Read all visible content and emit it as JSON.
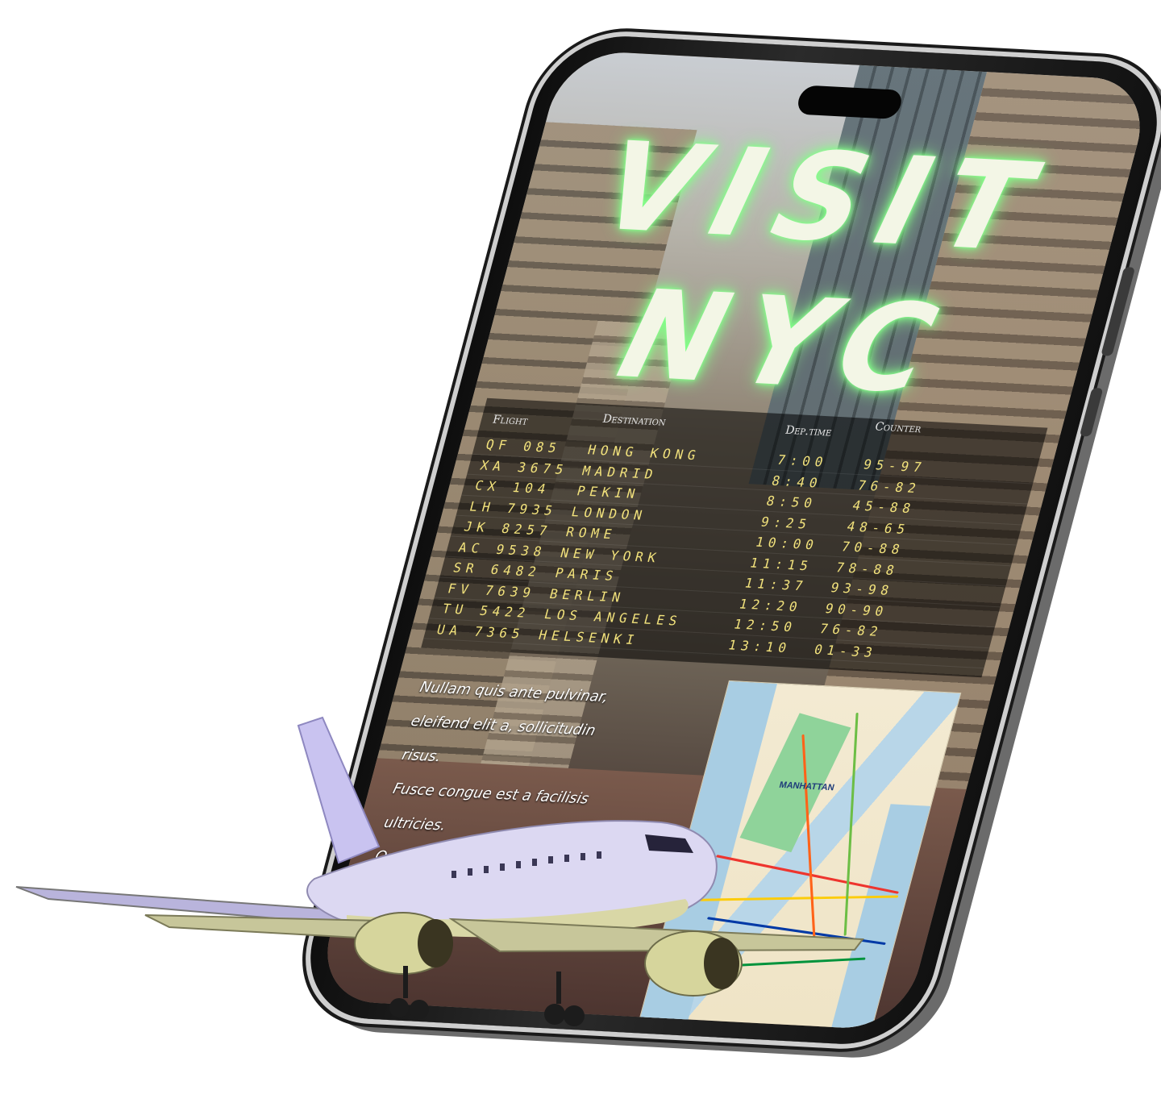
{
  "screen": {
    "title_line1": "VISIT",
    "title_line2": "NYC",
    "title_glow_color": "#7dff86"
  },
  "board": {
    "headers": {
      "flight": "Flight",
      "destination": "Destination",
      "dep_time": "Dep.time",
      "counter": "Counter"
    },
    "rows": [
      {
        "flight": "QF  085",
        "destination": "HONG KONG",
        "time": "7:00",
        "counter": "95-97"
      },
      {
        "flight": "XA  3675",
        "destination": "MADRID",
        "time": "8:40",
        "counter": "76-82"
      },
      {
        "flight": "CX  104",
        "destination": "PEKIN",
        "time": "8:50",
        "counter": "45-88"
      },
      {
        "flight": "LH  7935",
        "destination": "LONDON",
        "time": "9:25",
        "counter": "48-65"
      },
      {
        "flight": "JK  8257",
        "destination": "ROME",
        "time": "10:00",
        "counter": "70-88"
      },
      {
        "flight": "AC  9538",
        "destination": "NEW YORK",
        "time": "11:15",
        "counter": "78-88"
      },
      {
        "flight": "SR  6482",
        "destination": "PARIS",
        "time": "11:37",
        "counter": "93-98"
      },
      {
        "flight": "FV  7639",
        "destination": "BERLIN",
        "time": "12:20",
        "counter": "90-90"
      },
      {
        "flight": "TU  5422",
        "destination": "LOS ANGELES",
        "time": "12:50",
        "counter": "76-82"
      },
      {
        "flight": "UA  7365",
        "destination": "HELSENKI",
        "time": "13:10",
        "counter": "01-33"
      }
    ],
    "text_color": "#f2e27c"
  },
  "body": {
    "paragraphs": [
      "Nullam quis ante pulvinar, eleifend elit a, sollicitudin risus.",
      "Fusce congue est a facilisis ultricies.",
      "Quisque at nibh et magna fermentum"
    ]
  },
  "map": {
    "label": "MANHATTAN"
  }
}
